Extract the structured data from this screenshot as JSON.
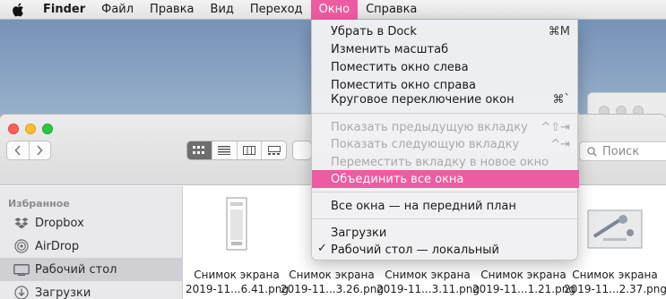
{
  "menubar": {
    "app_name": "Finder",
    "items": [
      "Файл",
      "Правка",
      "Вид",
      "Переход",
      "Окно",
      "Справка"
    ],
    "active_item": "Окно"
  },
  "window_menu": {
    "items": [
      {
        "label": "Убрать в Dock",
        "shortcut": "⌘M",
        "enabled": true
      },
      {
        "label": "Изменить масштаб",
        "shortcut": "",
        "enabled": true
      },
      {
        "label": "Поместить окно слева",
        "shortcut": "",
        "enabled": true
      },
      {
        "label": "Поместить окно справа",
        "shortcut": "",
        "enabled": true
      },
      {
        "label": "Круговое переключение окон",
        "shortcut": "⌘`",
        "enabled": true
      },
      {
        "label": "Показать предыдущую вкладку",
        "shortcut": "^⇧⇥",
        "enabled": false
      },
      {
        "label": "Показать следующую вкладку",
        "shortcut": "^⇥",
        "enabled": false
      },
      {
        "label": "Переместить вкладку в новое окно",
        "shortcut": "",
        "enabled": false
      },
      {
        "label": "Объединить все окна",
        "shortcut": "",
        "enabled": true,
        "highlighted": true
      },
      {
        "label": "Все окна — на передний план",
        "shortcut": "",
        "enabled": true
      },
      {
        "label": "Загрузки",
        "shortcut": "",
        "enabled": true
      },
      {
        "label": "Рабочий стол — локальный",
        "shortcut": "",
        "enabled": true,
        "checked": true
      }
    ]
  },
  "finder": {
    "search_placeholder": "Поиск",
    "sidebar": {
      "heading": "Избранное",
      "items": [
        {
          "label": "Dropbox",
          "icon": "dropbox-icon"
        },
        {
          "label": "AirDrop",
          "icon": "airdrop-icon"
        },
        {
          "label": "Рабочий стол",
          "icon": "desktop-icon",
          "selected": true
        },
        {
          "label": "Загрузки",
          "icon": "downloads-icon"
        }
      ]
    },
    "files": [
      {
        "name_line1": "Снимок экрана",
        "name_line2": "2019-11...6.41.png"
      },
      {
        "name_line1": "Снимок экрана",
        "name_line2": "2019-11...3.26.png"
      },
      {
        "name_line1": "Снимок экрана",
        "name_line2": "2019-11...3.11.png"
      },
      {
        "name_line1": "Снимок экрана",
        "name_line2": "2019-11...1.21.png"
      },
      {
        "name_line1": "Снимок экрана",
        "name_line2": "2019-11...2.37.png"
      }
    ]
  },
  "colors": {
    "accent": "#ee5ba0",
    "menu_bg": "#f1f1f3",
    "sidebar_bg": "#e9e9ec",
    "desktop_sky": "#9fb6cf"
  }
}
